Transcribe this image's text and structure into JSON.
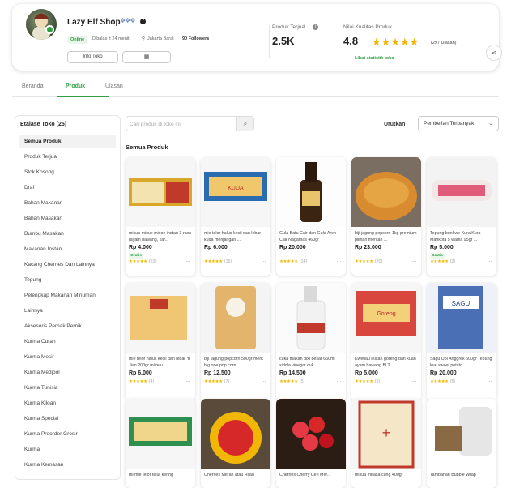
{
  "shop": {
    "name": "Lazy Elf Shop",
    "badges": "❖❖❖",
    "online": "Online",
    "last_online": "Dibalas ± 24 menit",
    "location": "Jakarta Barat",
    "followers": "90 Followers",
    "info_button": "Info Toko",
    "stats": {
      "sold_label": "Produk Terjual",
      "sold_value": "2.5K",
      "rating_label": "Nilai Kualitas Produk",
      "rating_value": "4.8",
      "rating_stars": "★★★★★",
      "reviews": "(297 Ulasan)",
      "stats_link": "Lihat statistik toko"
    }
  },
  "tabs": [
    {
      "label": "Beranda"
    },
    {
      "label": "Produk"
    },
    {
      "label": "Ulasan"
    }
  ],
  "sidebar": {
    "title": "Etalase Toko (25)",
    "items": [
      "Semua Produk",
      "Produk Terjual",
      "Stok Kosong",
      "Draf",
      "Bahan Makanan",
      "Bahan Masakan",
      "Bumbu Masakan",
      "Makanan Instan",
      "Kacang Cherries Dan Lainnya",
      "Tepung",
      "Pelengkap Makanan Minuman",
      "Lainnya",
      "Aksesoris Pernak Pernik",
      "Kurma Curah",
      "Kurma Mesir",
      "Kurma Medjool",
      "Kurma Tunisia",
      "Kurma Kiloan",
      "Kurma Special",
      "Kurma Preorder Grosir",
      "Kurma",
      "Kurma Kemasan"
    ]
  },
  "search": {
    "placeholder": "Cari produk di toko ini"
  },
  "sort": {
    "label": "Urutkan",
    "value": "Pembelian Terbanyak"
  },
  "section_title": "Semua Produk",
  "products": [
    {
      "name": "misua mixue mixoe instan 3 rasa (ayam bawang, kar...",
      "price": "Rp 4.000",
      "gratis": "Gratis",
      "stars": "★★★★★",
      "count": "(22)"
    },
    {
      "name": "mie telor halus kecil dan lebar kuda menjangan ...",
      "price": "Rp 6.000",
      "gratis": "",
      "stars": "★★★★★",
      "count": "(15)"
    },
    {
      "name": "Gula Batu Cair dan Gula Aren Cair Nagamas 460gr",
      "price": "Rp 20.000",
      "gratis": "",
      "stars": "★★★★★",
      "count": "(14)"
    },
    {
      "name": "biji jagung popcorn 1kg premium pilihan mentah ...",
      "price": "Rp 23.000",
      "gratis": "",
      "stars": "★★★★★",
      "count": "(20)"
    },
    {
      "name": "Tepung bunkwe Kura Kura Mahkota 5 wama 95gr ...",
      "price": "Rp 5.000",
      "gratis": "Gratis",
      "stars": "★★★★★",
      "count": "(2)"
    },
    {
      "name": "mie telor halus kecil dan lebar Yi Jian 200gr mi telu...",
      "price": "Rp 6.000",
      "gratis": "",
      "stars": "★★★★★",
      "count": "(4)"
    },
    {
      "name": "biji jagung popcorn 500gr merk big one pop corn ...",
      "price": "Rp 12.500",
      "gratis": "",
      "stars": "★★★★★",
      "count": "(7)"
    },
    {
      "name": "cuka makan dixi besar 650ml sidola vinegar cuk...",
      "price": "Rp 14.500",
      "gratis": "",
      "stars": "★★★★★",
      "count": "(5)"
    },
    {
      "name": "Kwetiau instan goreng dan kuah ayam bawang BLT ...",
      "price": "Rp 5.000",
      "gratis": "",
      "stars": "★★★★★",
      "count": "(6)"
    },
    {
      "name": "Sagu Ubi Anggrek 500gr Tepung kue sweet potato...",
      "price": "Rp 20.000",
      "gratis": "",
      "stars": "★★★★★",
      "count": "(5)"
    },
    {
      "name": "mi mie telor telur kering",
      "price": "",
      "gratis": "",
      "stars": "",
      "count": ""
    },
    {
      "name": "Cherries Merah atau Hijau",
      "price": "",
      "gratis": "",
      "stars": "",
      "count": ""
    },
    {
      "name": "Cherries Cherry Ceri Mer...",
      "price": "",
      "gratis": "",
      "stars": "",
      "count": ""
    },
    {
      "name": "misua mirasa cung 400gr",
      "price": "",
      "gratis": "",
      "stars": "",
      "count": ""
    },
    {
      "name": "Tambahan Bubble Wrap",
      "price": "",
      "gratis": "",
      "stars": "",
      "count": ""
    }
  ]
}
